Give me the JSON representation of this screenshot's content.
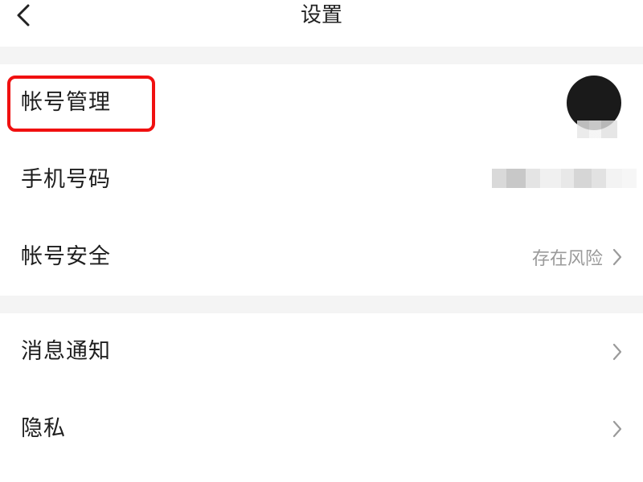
{
  "header": {
    "title": "设置"
  },
  "sections": {
    "account": {
      "rows": [
        {
          "label": "帐号管理",
          "value": ""
        },
        {
          "label": "手机号码",
          "value": ""
        },
        {
          "label": "帐号安全",
          "value": "存在风险"
        }
      ]
    },
    "general": {
      "rows": [
        {
          "label": "消息通知"
        },
        {
          "label": "隐私"
        }
      ]
    }
  },
  "colors": {
    "highlight": "#f01010",
    "secondary_text": "#9a9a9a",
    "divider": "#f4f4f4",
    "avatar": "#1a1a1a"
  },
  "icons": {
    "back": "chevron-left-icon",
    "row_arrow": "chevron-right-icon"
  }
}
